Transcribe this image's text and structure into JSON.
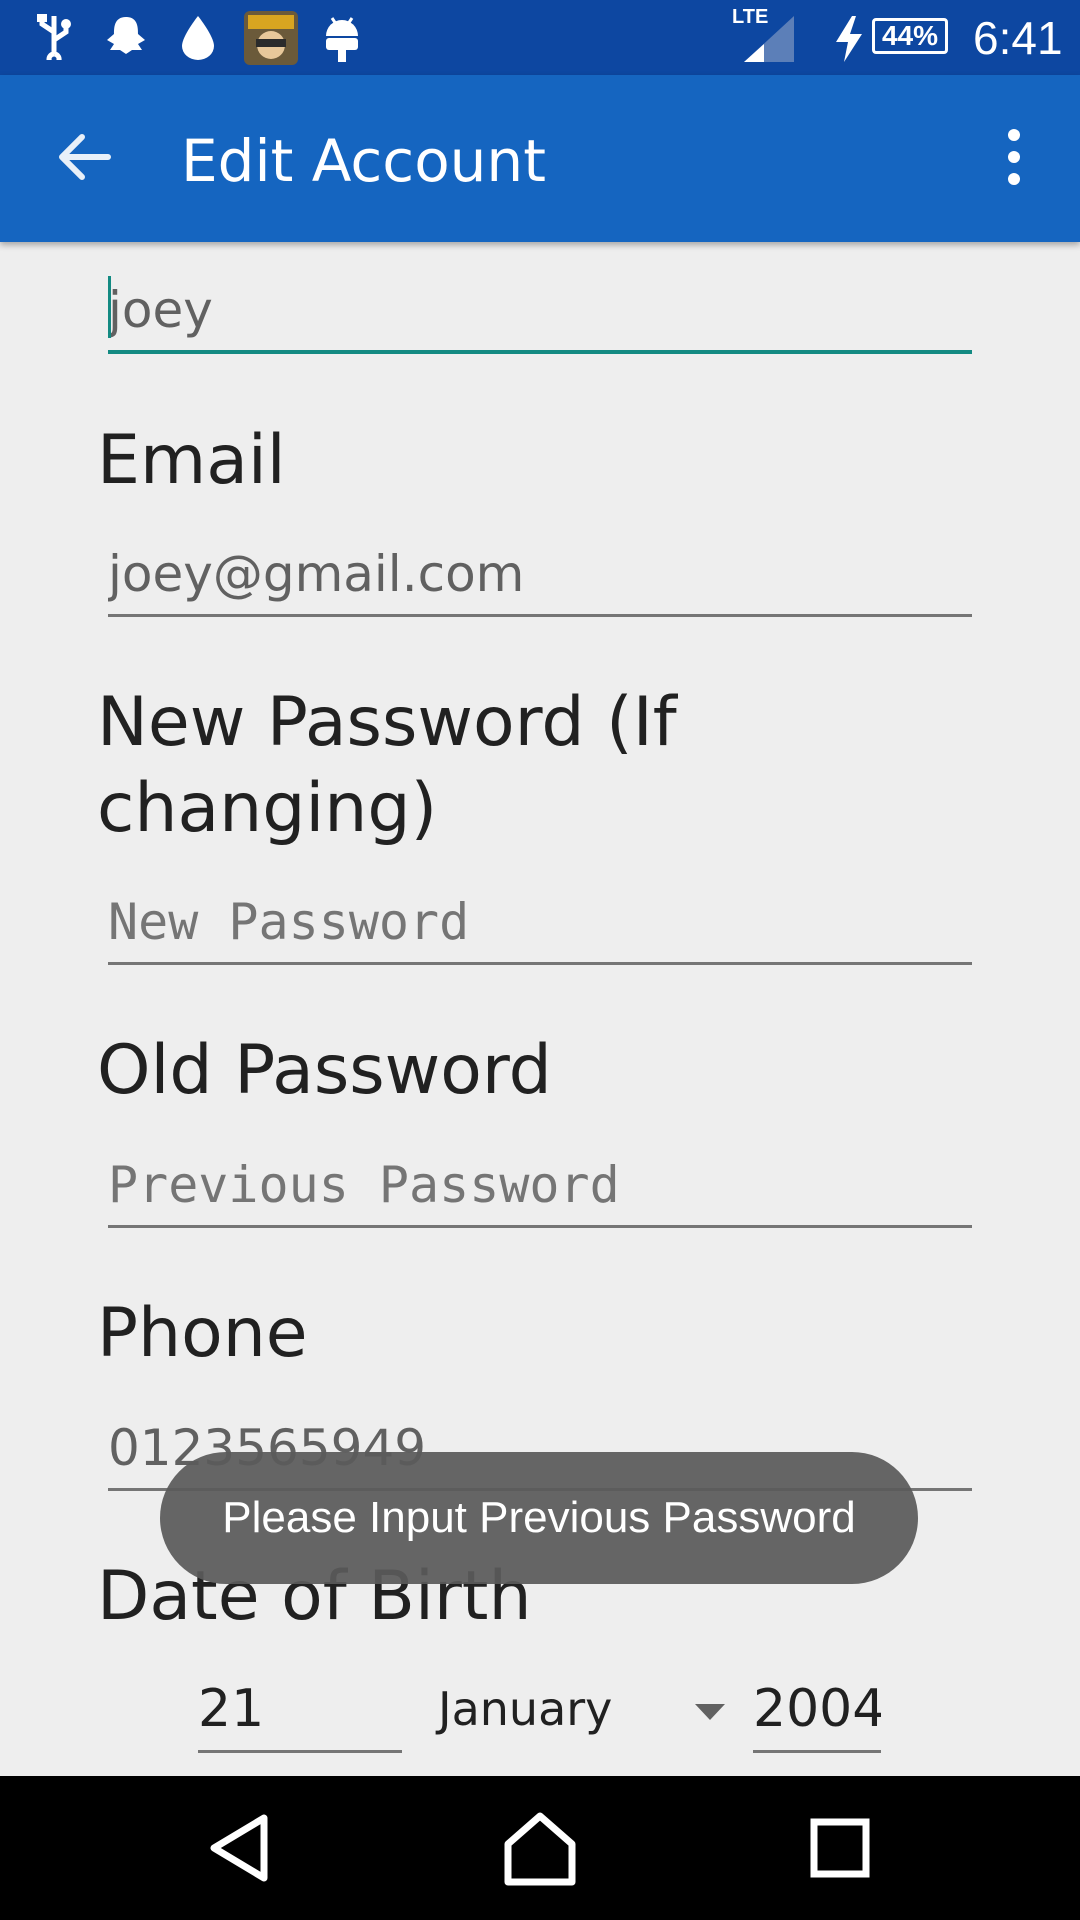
{
  "status_bar": {
    "time": "6:41",
    "battery": "44%",
    "network": "LTE",
    "icons": [
      "usb-icon",
      "ghost-icon",
      "drop-icon",
      "game-app-icon",
      "android-icon",
      "signal-icon",
      "charging-icon",
      "battery-icon"
    ]
  },
  "app_bar": {
    "title": "Edit Account",
    "color": "#1565c0",
    "status_color": "#0d47a1"
  },
  "form": {
    "name_value": "joey",
    "email_label": "Email",
    "email_value": "joey@gmail.com",
    "new_password_label_line1": "New Password (If",
    "new_password_label_line2": "changing)",
    "new_password_placeholder": "New Password",
    "old_password_label": "Old Password",
    "old_password_placeholder": "Previous Password",
    "phone_label": "Phone",
    "phone_value": "0123565949",
    "dob_label": "Date of Birth",
    "dob_day": "21",
    "dob_month": "January",
    "dob_year": "2004",
    "accent_color": "#138a82"
  },
  "toast": {
    "message": "Please Input Previous Password"
  }
}
